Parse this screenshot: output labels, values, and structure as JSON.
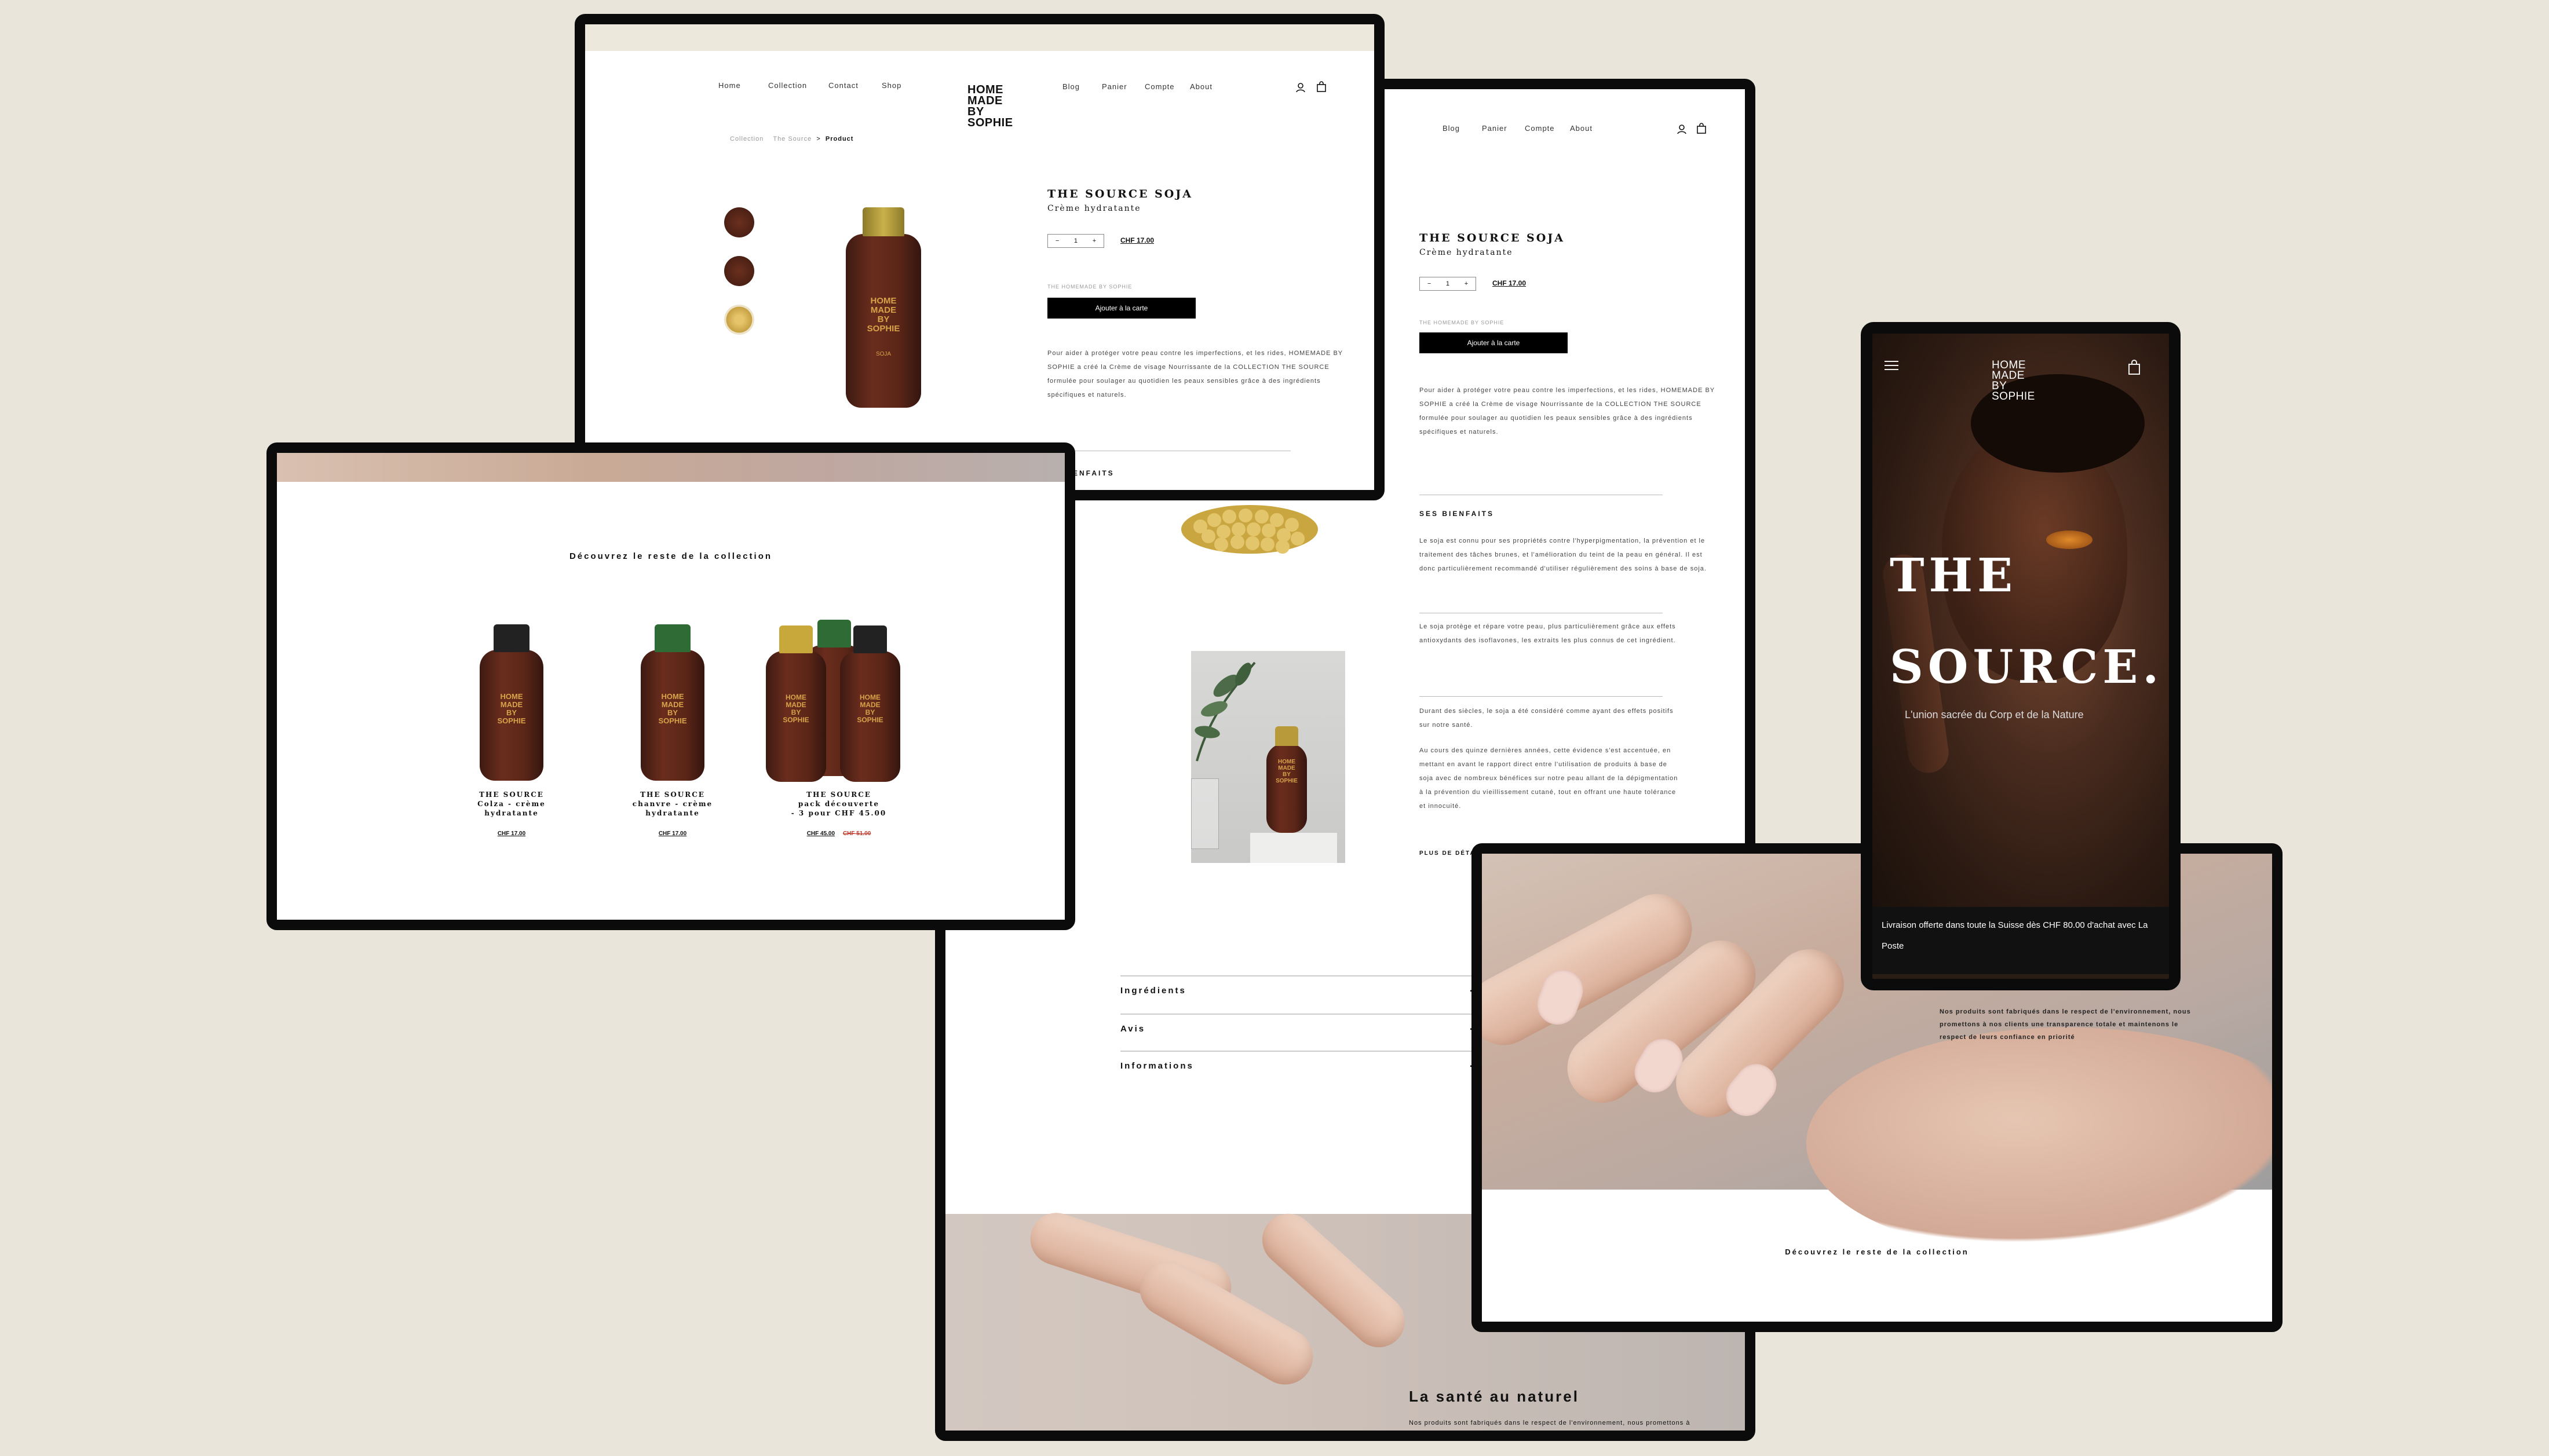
{
  "desktop_top": {
    "nav_left": [
      "Home",
      "Collection",
      "Contact",
      "Shop"
    ],
    "logo": "HOME\nMADE\nBY\nSOPHIE",
    "nav_right": [
      "Blog",
      "Panier",
      "Compte",
      "About"
    ],
    "breadcrumb": {
      "a": "Collection",
      "b": "The Source",
      "sep": ">",
      "current": "Product"
    },
    "product_title": "THE SOURCE SOJA",
    "product_subtitle": "Crème hydratante",
    "qty": {
      "minus": "−",
      "value": "1",
      "plus": "+"
    },
    "price": "CHF 17.00",
    "brand_line": "THE HOMEMADE BY SOPHIE",
    "add_to_cart": "Ajouter à la carte",
    "description": "Pour aider à protéger votre peau contre les imperfections, et les rides, HOMEMADE BY SOPHIE a créé la Crème de visage Nourrissante de la COLLECTION THE SOURCE formulée pour soulager au quotidien les peaux sensibles grâce à des ingrédients spécifiques et naturels.",
    "section_bienfaits": "BIENFAITS",
    "bottle_label": "HOME\nMADE\nBY\nSOPHIE",
    "bottle_sub": "SOJA"
  },
  "collection": {
    "heading": "Découvrez le reste de la collection",
    "products": [
      {
        "name": "THE SOURCE\nColza - crème\nhydratante",
        "price": "CHF 17.00",
        "old_price": ""
      },
      {
        "name": "THE SOURCE\nchanvre - crème\nhydratante",
        "price": "CHF 17.00",
        "old_price": ""
      },
      {
        "name": "THE SOURCE\npack découverte\n- 3 pour CHF 45.00",
        "price": "CHF 45.00",
        "old_price": "CHF 51.00"
      }
    ]
  },
  "desktop_long": {
    "nav_right": [
      "Blog",
      "Panier",
      "Compte",
      "About"
    ],
    "product_title": "THE SOURCE SOJA",
    "product_subtitle": "Crème hydratante",
    "qty": {
      "minus": "−",
      "value": "1",
      "plus": "+"
    },
    "price": "CHF 17.00",
    "brand_line": "THE HOMEMADE BY SOPHIE",
    "add_to_cart": "Ajouter à la carte",
    "description": "Pour aider à protéger votre peau contre les imperfections, et les rides, HOMEMADE BY SOPHIE a créé la Crème de visage Nourrissante de la COLLECTION THE SOURCE formulée pour soulager au quotidien les peaux sensibles grâce à des ingrédients spécifiques et naturels.",
    "section_title": "SES BIENFAITS",
    "para1": "Le soja est connu pour ses propriétés contre l'hyperpigmentation, la prévention et le traitement des tâches brunes, et l'amélioration du teint de la peau en général. Il est donc particulièrement recommandé d'utiliser régulièrement des soins à base de soja.",
    "para2": "Le soja protège et répare votre peau, plus particulièrement grâce aux effets antioxydants des isoflavones, les extraits les plus connus de cet ingrédient.",
    "para3": "Durant des siècles, le soja a été considéré comme ayant des effets positifs sur notre santé.",
    "para4": "Au cours des quinze dernières années, cette évidence s'est accentuée, en mettant en avant le rapport direct entre l'utilisation de produits à base de soja avec de nombreux bénéfices sur notre peau allant de la dépigmentation à la prévention du vieillissement cutané, tout en offrant une haute tolérance et innocuité.",
    "more_link": "PLUS DE DÉTAILS",
    "accordion": [
      "Ingrédients",
      "Avis",
      "Informations"
    ],
    "footer_heading": "La santé au naturel",
    "footer_text": "Nos produits sont fabriqués dans le respect de l'environnement, nous promettons à nos clients une transparence totale"
  },
  "right_desktop": {
    "text": "Nos produits sont fabriqués dans le respect de l'environnement, nous promettons à nos clients une transparence totale et maintenons le respect de leurs confiance en priorité",
    "heading": "Découvrez le reste de la collection"
  },
  "mobile": {
    "logo": "HOME\nMADE\nBY\nSOPHIE",
    "hero_line1": "THE",
    "hero_line2": "SOURCE.",
    "tagline": "L'union sacrée du Corp et de la Nature",
    "banner": "Livraison offerte dans toute la Suisse dès CHF 80.00 d'achat avec La Poste"
  },
  "colors": {
    "background": "#eae5da",
    "frame": "#0b0b0b",
    "bottle": "#5b2617",
    "gold": "#c9a83b",
    "green": "#2f6b34"
  }
}
